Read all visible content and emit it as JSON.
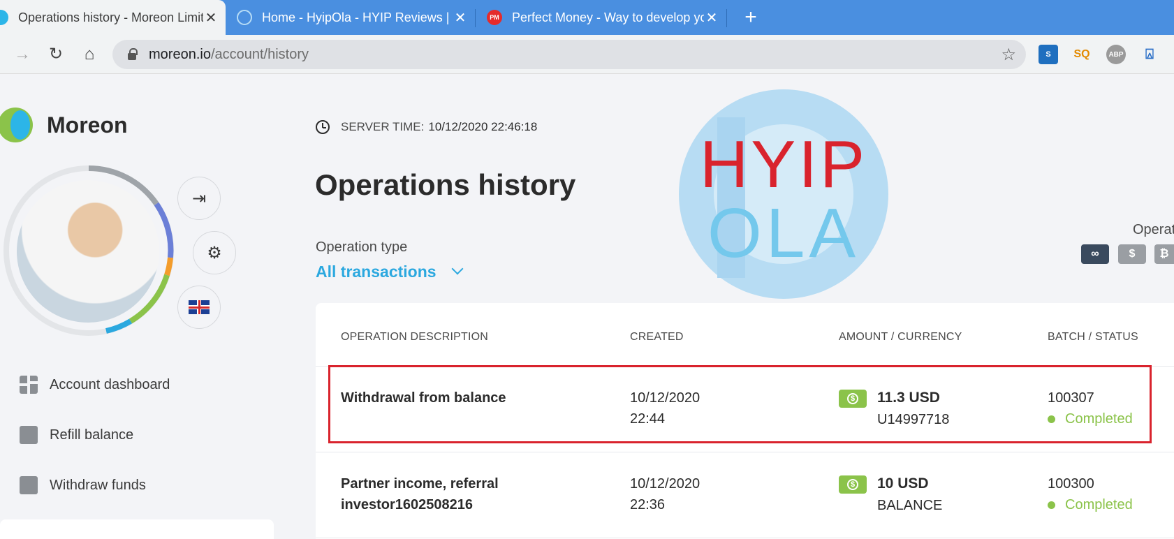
{
  "browser": {
    "tabs": [
      {
        "title": "Operations history - Moreon Limited",
        "active": true
      },
      {
        "title": "Home - HyipOla - HYIP Reviews | Latest HYIP Programs",
        "active": false
      },
      {
        "title": "Perfect Money - Way to develop your money",
        "active": false
      }
    ],
    "new_tab_symbol": "+",
    "close_symbol": "✕",
    "url_host": "moreon.io",
    "url_path": "/account/history",
    "extensions": {
      "s": "S",
      "sq": "SQ",
      "abp": "ABP",
      "acc": "⍓"
    }
  },
  "sidebar": {
    "brand": "Moreon",
    "menu": [
      {
        "label": "Account dashboard"
      },
      {
        "label": "Refill balance"
      },
      {
        "label": "Withdraw funds"
      }
    ]
  },
  "header": {
    "server_time_label": "SERVER TIME:",
    "server_time_value": "10/12/2020 22:46:18",
    "page_title": "Operations history"
  },
  "filters": {
    "operation_type_label": "Operation type",
    "operation_type_value": "All transactions",
    "operations_currency_label": "Operat",
    "currency_buttons": [
      {
        "symbol": "∞",
        "active": true
      },
      {
        "symbol": "$",
        "active": false
      },
      {
        "symbol": "₿",
        "active": false
      }
    ]
  },
  "watermark": {
    "line1": "HYIP",
    "line2": "OLA"
  },
  "table": {
    "headers": [
      "OPERATION DESCRIPTION",
      "CREATED",
      "AMOUNT / CURRENCY",
      "BATCH / STATUS"
    ],
    "rows": [
      {
        "description_1": "Withdrawal from balance",
        "description_2": "",
        "date": "10/12/2020",
        "time": "22:44",
        "amount": "11.3 USD",
        "account": "U14997718",
        "batch": "100307",
        "status": "Completed"
      },
      {
        "description_1": "Partner income, referral",
        "description_2": "investor1602508216",
        "date": "10/12/2020",
        "time": "22:36",
        "amount": "10 USD",
        "account": "BALANCE",
        "batch": "100300",
        "status": "Completed"
      }
    ]
  }
}
